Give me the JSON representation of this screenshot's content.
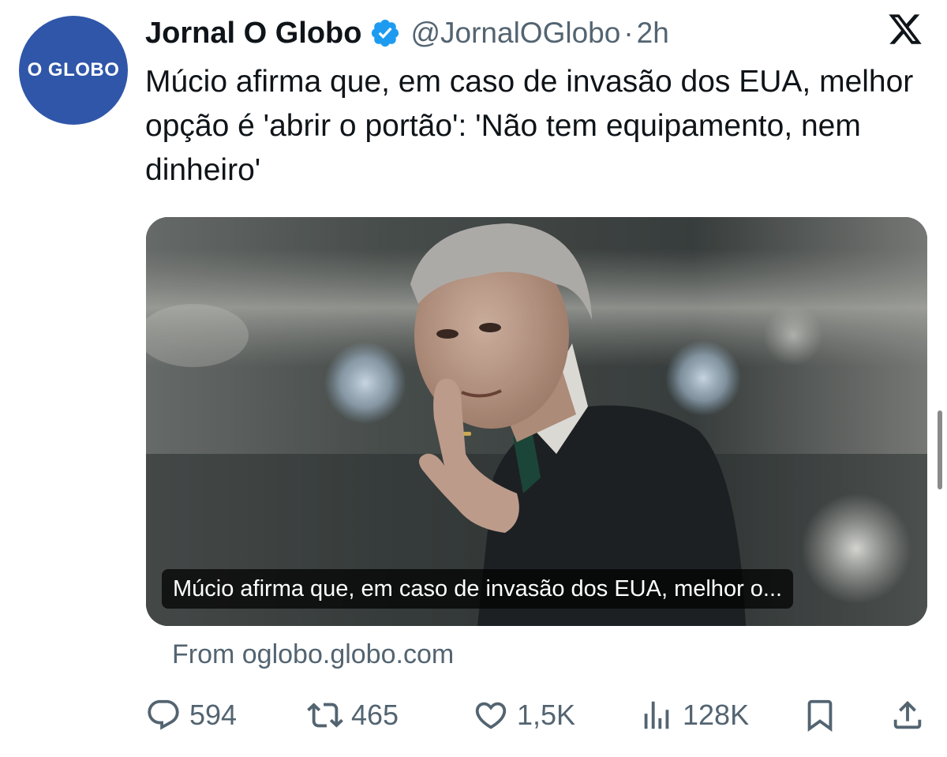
{
  "author": {
    "avatar_text": "O GLOBO",
    "display_name": "Jornal O Globo",
    "handle": "@JornalOGlobo",
    "separator": "·",
    "time": "2h"
  },
  "tweet": {
    "text": "Múcio afirma que, em caso de invasão dos EUA, melhor opção é 'abrir o portão': 'Não tem equipamento, nem dinheiro'"
  },
  "card": {
    "caption": "Múcio afirma que, em caso de invasão dos EUA, melhor o...",
    "source": "From oglobo.globo.com"
  },
  "actions": {
    "replies": "594",
    "reposts": "465",
    "likes": "1,5K",
    "views": "128K"
  },
  "icons": {
    "verified": "verified-badge-icon",
    "platform": "x-logo-icon",
    "reply": "reply-icon",
    "repost": "repost-icon",
    "like": "heart-icon",
    "views": "views-icon",
    "bookmark": "bookmark-icon",
    "share": "share-icon"
  },
  "colors": {
    "brand_avatar": "#2f56a8",
    "verified": "#1d9bf0",
    "text_primary": "#0f1419",
    "text_secondary": "#536471"
  }
}
